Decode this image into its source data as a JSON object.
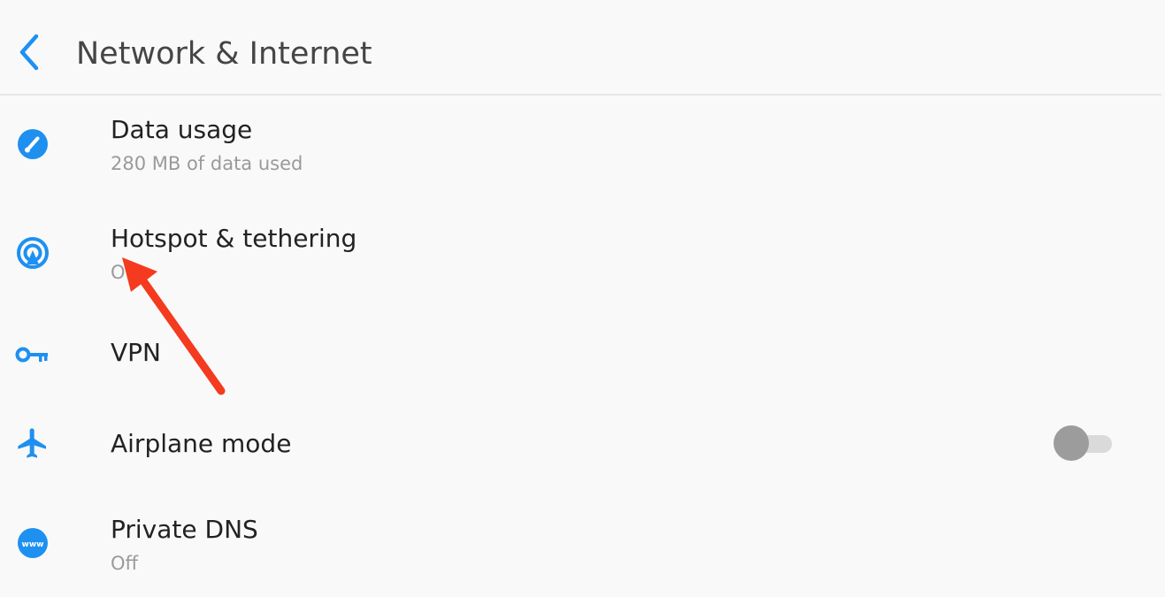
{
  "header": {
    "title": "Network & Internet",
    "back_icon": "chevron-left-icon"
  },
  "colors": {
    "accent": "#1e90f0",
    "annotation_arrow": "#f43a1f",
    "toggle_off_thumb": "#9c9c9c",
    "toggle_off_track": "#dadada"
  },
  "settings": {
    "items": [
      {
        "title": "Data usage",
        "summary": "280 MB of data used",
        "icon": "data-usage-gauge-icon"
      },
      {
        "title": "Hotspot & tethering",
        "summary": "Off",
        "icon": "hotspot-icon"
      },
      {
        "title": "VPN",
        "summary": "",
        "icon": "key-icon"
      },
      {
        "title": "Airplane mode",
        "summary": "",
        "icon": "airplane-icon",
        "toggle": {
          "state": "off"
        }
      },
      {
        "title": "Private DNS",
        "summary": "Off",
        "icon": "www-globe-icon"
      }
    ]
  }
}
